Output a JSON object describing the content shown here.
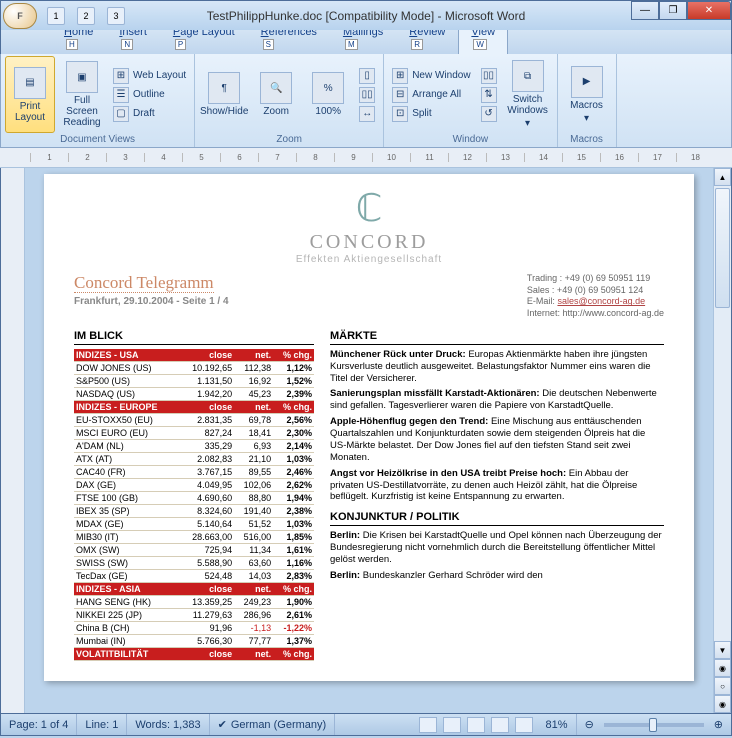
{
  "window": {
    "title": "TestPhilippHunke.doc [Compatibility Mode] - Microsoft Word",
    "office_hotkey": "F",
    "qat": [
      "1",
      "2",
      "3"
    ]
  },
  "tabs": {
    "items": [
      {
        "label": "Home",
        "key": "H"
      },
      {
        "label": "Insert",
        "key": "N"
      },
      {
        "label": "Page Layout",
        "key": "P"
      },
      {
        "label": "References",
        "key": "S"
      },
      {
        "label": "Mailings",
        "key": "M"
      },
      {
        "label": "Review",
        "key": "R"
      },
      {
        "label": "View",
        "key": "W"
      }
    ],
    "active": 6
  },
  "ribbon": {
    "docviews": {
      "print": "Print Layout",
      "fullscreen": "Full Screen Reading",
      "web": "Web Layout",
      "outline": "Outline",
      "draft": "Draft",
      "label": "Document Views"
    },
    "zoom": {
      "showhide": "Show/Hide",
      "zoom": "Zoom",
      "hundred": "100%",
      "label": "Zoom"
    },
    "window": {
      "new": "New Window",
      "arrange": "Arrange All",
      "split": "Split",
      "switch": "Switch Windows",
      "label": "Window"
    },
    "macros": {
      "btn": "Macros",
      "label": "Macros"
    }
  },
  "document": {
    "logo": {
      "brand": "CONCORD",
      "sub": "Effekten Aktiengesellschaft"
    },
    "head": {
      "title": "Concord Telegramm",
      "dateline": "Frankfurt, 29.10.2004 - Seite 1 / 4",
      "contact": {
        "trading": "Trading : +49 (0) 69 50951 119",
        "sales": "Sales : +49 (0) 69 50951 124",
        "email_label": "E-Mail: ",
        "email": "sales@concord-ag.de",
        "web": "Internet: http://www.concord-ag.de"
      }
    },
    "imblick": "IM BLICK",
    "markte": "MÄRKTE",
    "konjunktur": "KONJUNKTUR / POLITIK",
    "groups": [
      {
        "hdr": [
          "INDIZES - USA",
          "close",
          "net.",
          "% chg."
        ],
        "rows": [
          [
            "DOW JONES (US)",
            "10.192,65",
            "112,38",
            "1,12%"
          ],
          [
            "S&P500 (US)",
            "1.131,50",
            "16,92",
            "1,52%"
          ],
          [
            "NASDAQ (US)",
            "1.942,20",
            "45,23",
            "2,39%"
          ]
        ]
      },
      {
        "hdr": [
          "INDIZES - EUROPE",
          "close",
          "net.",
          "% chg."
        ],
        "rows": [
          [
            "EU-STOXX50 (EU)",
            "2.831,35",
            "69,78",
            "2,56%"
          ],
          [
            "MSCI EURO (EU)",
            "827,24",
            "18,41",
            "2,30%"
          ],
          [
            "A'DAM (NL)",
            "335,29",
            "6,93",
            "2,14%"
          ],
          [
            "ATX (AT)",
            "2.082,83",
            "21,10",
            "1,03%"
          ],
          [
            "CAC40 (FR)",
            "3.767,15",
            "89,55",
            "2,46%"
          ],
          [
            "DAX (GE)",
            "4.049,95",
            "102,06",
            "2,62%"
          ],
          [
            "FTSE 100 (GB)",
            "4.690,60",
            "88,80",
            "1,94%"
          ],
          [
            "IBEX 35 (SP)",
            "8.324,60",
            "191,40",
            "2,38%"
          ],
          [
            "MDAX (GE)",
            "5.140,64",
            "51,52",
            "1,03%"
          ],
          [
            "MIB30 (IT)",
            "28.663,00",
            "516,00",
            "1,85%"
          ],
          [
            "OMX (SW)",
            "725,94",
            "11,34",
            "1,61%"
          ],
          [
            "SWISS (SW)",
            "5.588,90",
            "63,60",
            "1,16%"
          ],
          [
            "TecDax (GE)",
            "524,48",
            "14,03",
            "2,83%"
          ]
        ]
      },
      {
        "hdr": [
          "INDIZES - ASIA",
          "close",
          "net.",
          "% chg."
        ],
        "rows": [
          [
            "HANG SENG (HK)",
            "13.359,25",
            "249,23",
            "1,90%"
          ],
          [
            "NIKKEI 225 (JP)",
            "11.279,63",
            "286,96",
            "2,61%"
          ],
          [
            "China B (CH)",
            "91,96",
            "-1,13",
            "-1,22%",
            true
          ],
          [
            "Mumbai (IN)",
            "5.766,30",
            "77,77",
            "1,37%"
          ]
        ]
      },
      {
        "hdr": [
          "VOLATITBILITÄT",
          "close",
          "net.",
          "% chg."
        ],
        "rows": []
      }
    ],
    "articles": [
      {
        "b": "Münchener Rück unter Druck: ",
        "t": "Europas Aktienmärkte haben ihre jüngsten Kursverluste deutlich ausgeweitet. Belastungsfaktor Nummer eins waren die Titel der Versicherer."
      },
      {
        "b": "Sanierungsplan missfällt Karstadt-Aktionären: ",
        "t": "Die deutschen Nebenwerte sind gefallen. Tagesverlierer waren die Papiere von KarstadtQuelle."
      },
      {
        "b": "Apple-Höhenflug gegen den Trend: ",
        "t": "Eine Mischung aus enttäuschenden Quartalszahlen und Konjunkturdaten sowie dem steigenden Ölpreis hat die US-Märkte belastet. Der Dow Jones fiel auf den tiefsten Stand seit zwei Monaten."
      },
      {
        "b": "Angst vor Heizölkrise in den USA treibt Preise hoch: ",
        "t": "Ein Abbau der privaten US-Destillatvorräte, zu denen auch Heizöl zählt, hat die Ölpreise beflügelt. Kurzfristig ist keine Entspannung zu erwarten."
      }
    ],
    "articles2": [
      {
        "b": "Berlin: ",
        "t": "Die Krisen bei KarstadtQuelle und Opel können nach Überzeugung der Bundesregierung nicht vornehmlich durch die Bereitstellung öffentlicher Mittel gelöst werden."
      },
      {
        "b": "Berlin: ",
        "t": "Bundeskanzler Gerhard Schröder wird den"
      }
    ]
  },
  "status": {
    "page": "Page: 1 of 4",
    "line": "Line: 1",
    "words": "Words: 1,383",
    "lang": "German (Germany)",
    "zoom": "81%"
  }
}
